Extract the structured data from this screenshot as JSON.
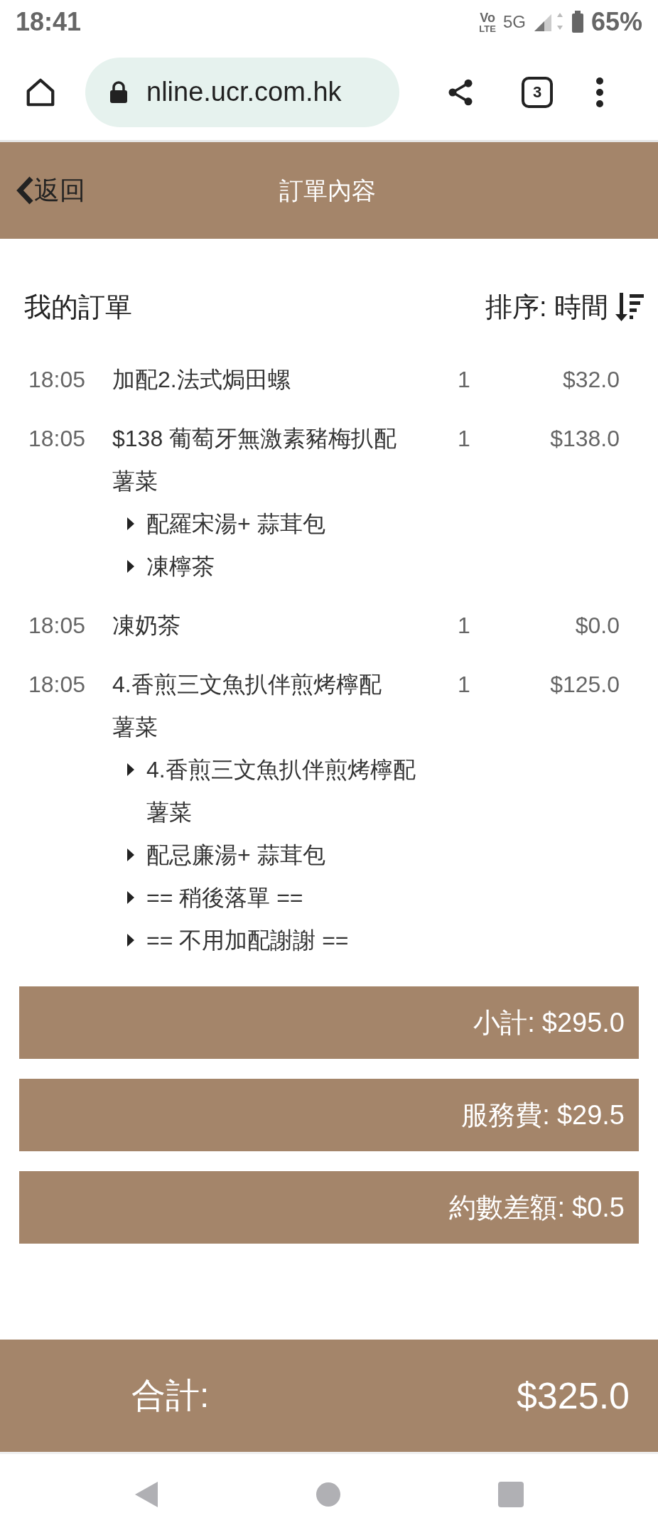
{
  "status_bar": {
    "time": "18:41",
    "volte_top": "Vo",
    "volte_bottom": "LTE",
    "network": "5G",
    "battery": "65%"
  },
  "browser": {
    "url": "nline.ucr.com.hk",
    "tab_count": "3"
  },
  "header": {
    "back": "返回",
    "title": "訂單內容"
  },
  "orders": {
    "heading": "我的訂單",
    "sort_label": "排序:",
    "sort_value": "時間",
    "items": [
      {
        "time": "18:05",
        "name": "加配2.法式焗田螺",
        "qty": "1",
        "price": "$32.0"
      },
      {
        "time": "18:05",
        "name": "$138 葡萄牙無激素豬梅扒配薯菜",
        "qty": "1",
        "price": "$138.0",
        "options": [
          "配羅宋湯+ 蒜茸包",
          "凍檸茶"
        ]
      },
      {
        "time": "18:05",
        "name": "凍奶茶",
        "qty": "1",
        "price": "$0.0"
      },
      {
        "time": "18:05",
        "name": "4.香煎三文魚扒伴煎烤檸配薯菜",
        "qty": "1",
        "price": "$125.0",
        "options": [
          "4.香煎三文魚扒伴煎烤檸配薯菜",
          "配忌廉湯+ 蒜茸包",
          "== 稍後落單 ==",
          "== 不用加配謝謝 =="
        ]
      }
    ]
  },
  "summary": [
    {
      "label": "小計:",
      "value": "$295.0"
    },
    {
      "label": "服務費:",
      "value": "$29.5"
    },
    {
      "label": "約數差額:",
      "value": "$0.5"
    }
  ],
  "total": {
    "label": "合計:",
    "value": "$325.0"
  }
}
